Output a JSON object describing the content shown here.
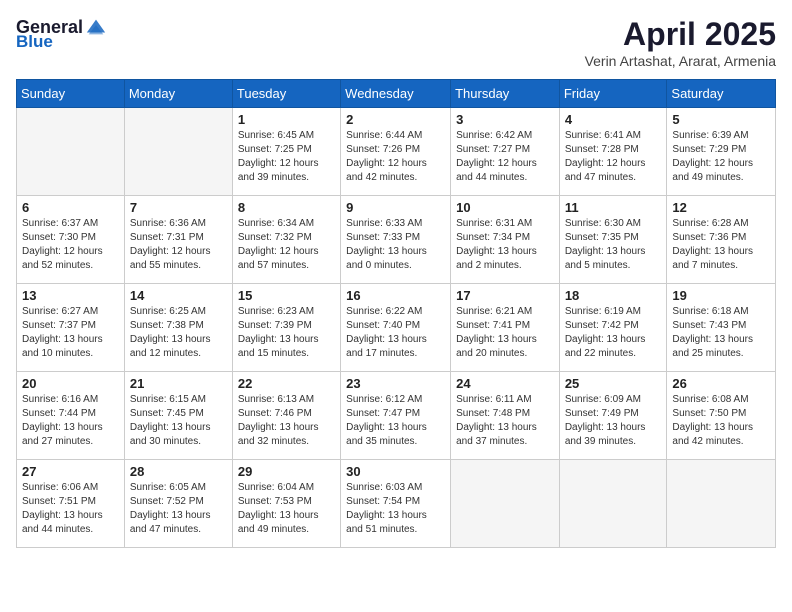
{
  "logo": {
    "text_general": "General",
    "text_blue": "Blue"
  },
  "title": "April 2025",
  "subtitle": "Verin Artashat, Ararat, Armenia",
  "days_of_week": [
    "Sunday",
    "Monday",
    "Tuesday",
    "Wednesday",
    "Thursday",
    "Friday",
    "Saturday"
  ],
  "weeks": [
    [
      {
        "day": "",
        "info": ""
      },
      {
        "day": "",
        "info": ""
      },
      {
        "day": "1",
        "info": "Sunrise: 6:45 AM\nSunset: 7:25 PM\nDaylight: 12 hours and 39 minutes."
      },
      {
        "day": "2",
        "info": "Sunrise: 6:44 AM\nSunset: 7:26 PM\nDaylight: 12 hours and 42 minutes."
      },
      {
        "day": "3",
        "info": "Sunrise: 6:42 AM\nSunset: 7:27 PM\nDaylight: 12 hours and 44 minutes."
      },
      {
        "day": "4",
        "info": "Sunrise: 6:41 AM\nSunset: 7:28 PM\nDaylight: 12 hours and 47 minutes."
      },
      {
        "day": "5",
        "info": "Sunrise: 6:39 AM\nSunset: 7:29 PM\nDaylight: 12 hours and 49 minutes."
      }
    ],
    [
      {
        "day": "6",
        "info": "Sunrise: 6:37 AM\nSunset: 7:30 PM\nDaylight: 12 hours and 52 minutes."
      },
      {
        "day": "7",
        "info": "Sunrise: 6:36 AM\nSunset: 7:31 PM\nDaylight: 12 hours and 55 minutes."
      },
      {
        "day": "8",
        "info": "Sunrise: 6:34 AM\nSunset: 7:32 PM\nDaylight: 12 hours and 57 minutes."
      },
      {
        "day": "9",
        "info": "Sunrise: 6:33 AM\nSunset: 7:33 PM\nDaylight: 13 hours and 0 minutes."
      },
      {
        "day": "10",
        "info": "Sunrise: 6:31 AM\nSunset: 7:34 PM\nDaylight: 13 hours and 2 minutes."
      },
      {
        "day": "11",
        "info": "Sunrise: 6:30 AM\nSunset: 7:35 PM\nDaylight: 13 hours and 5 minutes."
      },
      {
        "day": "12",
        "info": "Sunrise: 6:28 AM\nSunset: 7:36 PM\nDaylight: 13 hours and 7 minutes."
      }
    ],
    [
      {
        "day": "13",
        "info": "Sunrise: 6:27 AM\nSunset: 7:37 PM\nDaylight: 13 hours and 10 minutes."
      },
      {
        "day": "14",
        "info": "Sunrise: 6:25 AM\nSunset: 7:38 PM\nDaylight: 13 hours and 12 minutes."
      },
      {
        "day": "15",
        "info": "Sunrise: 6:23 AM\nSunset: 7:39 PM\nDaylight: 13 hours and 15 minutes."
      },
      {
        "day": "16",
        "info": "Sunrise: 6:22 AM\nSunset: 7:40 PM\nDaylight: 13 hours and 17 minutes."
      },
      {
        "day": "17",
        "info": "Sunrise: 6:21 AM\nSunset: 7:41 PM\nDaylight: 13 hours and 20 minutes."
      },
      {
        "day": "18",
        "info": "Sunrise: 6:19 AM\nSunset: 7:42 PM\nDaylight: 13 hours and 22 minutes."
      },
      {
        "day": "19",
        "info": "Sunrise: 6:18 AM\nSunset: 7:43 PM\nDaylight: 13 hours and 25 minutes."
      }
    ],
    [
      {
        "day": "20",
        "info": "Sunrise: 6:16 AM\nSunset: 7:44 PM\nDaylight: 13 hours and 27 minutes."
      },
      {
        "day": "21",
        "info": "Sunrise: 6:15 AM\nSunset: 7:45 PM\nDaylight: 13 hours and 30 minutes."
      },
      {
        "day": "22",
        "info": "Sunrise: 6:13 AM\nSunset: 7:46 PM\nDaylight: 13 hours and 32 minutes."
      },
      {
        "day": "23",
        "info": "Sunrise: 6:12 AM\nSunset: 7:47 PM\nDaylight: 13 hours and 35 minutes."
      },
      {
        "day": "24",
        "info": "Sunrise: 6:11 AM\nSunset: 7:48 PM\nDaylight: 13 hours and 37 minutes."
      },
      {
        "day": "25",
        "info": "Sunrise: 6:09 AM\nSunset: 7:49 PM\nDaylight: 13 hours and 39 minutes."
      },
      {
        "day": "26",
        "info": "Sunrise: 6:08 AM\nSunset: 7:50 PM\nDaylight: 13 hours and 42 minutes."
      }
    ],
    [
      {
        "day": "27",
        "info": "Sunrise: 6:06 AM\nSunset: 7:51 PM\nDaylight: 13 hours and 44 minutes."
      },
      {
        "day": "28",
        "info": "Sunrise: 6:05 AM\nSunset: 7:52 PM\nDaylight: 13 hours and 47 minutes."
      },
      {
        "day": "29",
        "info": "Sunrise: 6:04 AM\nSunset: 7:53 PM\nDaylight: 13 hours and 49 minutes."
      },
      {
        "day": "30",
        "info": "Sunrise: 6:03 AM\nSunset: 7:54 PM\nDaylight: 13 hours and 51 minutes."
      },
      {
        "day": "",
        "info": ""
      },
      {
        "day": "",
        "info": ""
      },
      {
        "day": "",
        "info": ""
      }
    ]
  ]
}
